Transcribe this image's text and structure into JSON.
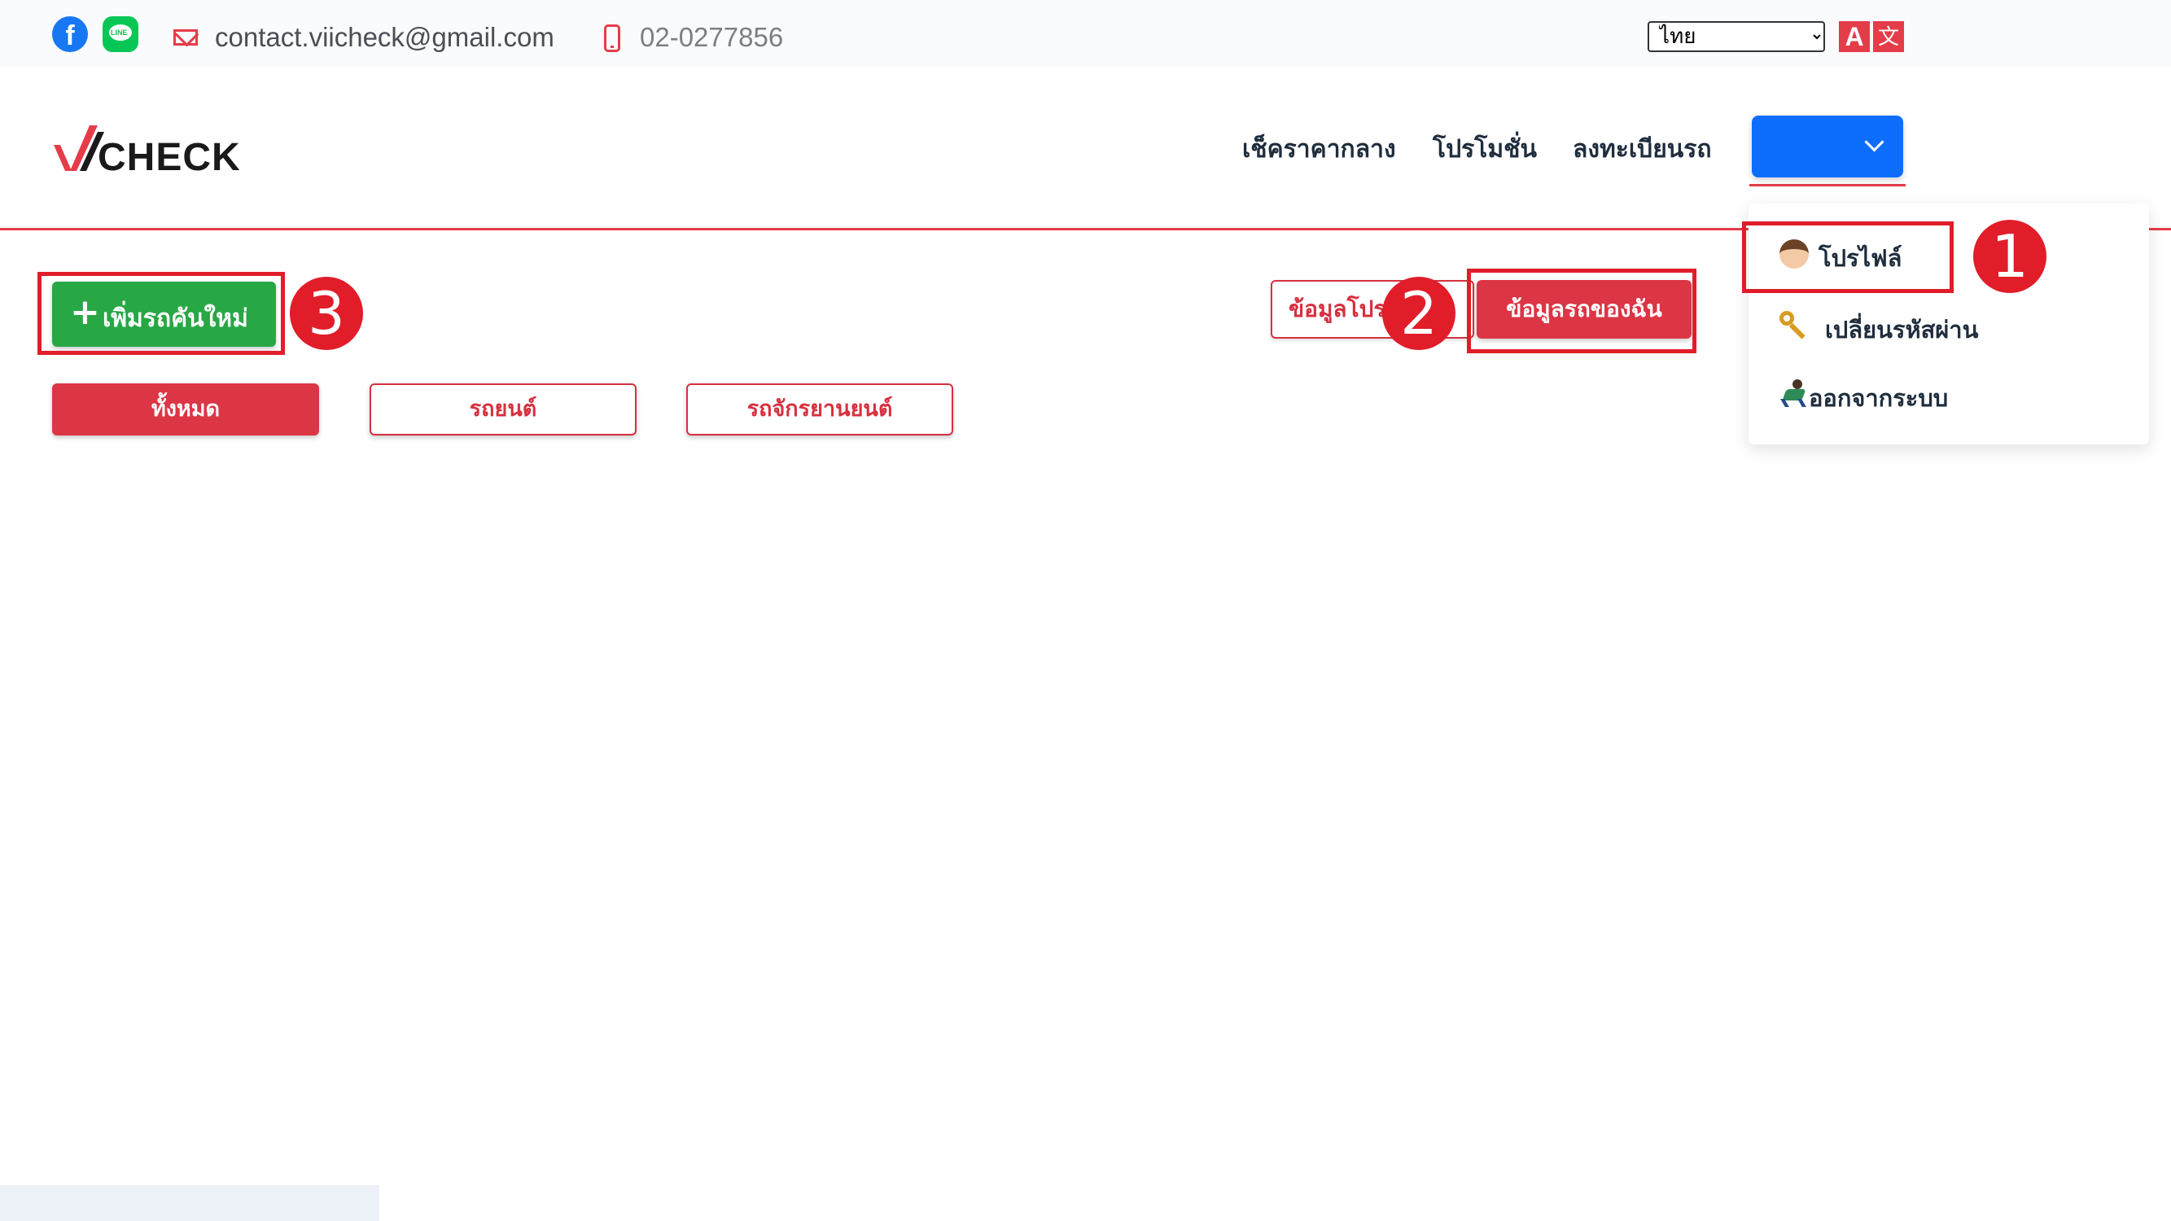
{
  "topbar": {
    "email": "contact.viicheck@gmail.com",
    "phone": "02-0277856",
    "language": {
      "selected": "ไทย",
      "options": [
        "ไทย"
      ]
    },
    "social_icons": [
      "facebook-icon",
      "line-icon"
    ],
    "line_icon_text": "LINE"
  },
  "header": {
    "logo_text": "CHECK",
    "nav": [
      "เช็คราคากลาง",
      "โปรโมชั่น",
      "ลงทะเบียนรถ"
    ]
  },
  "dropdown": {
    "items": [
      {
        "label": "โปรไฟล์",
        "icon": "face-icon"
      },
      {
        "label": "เปลี่ยนรหัสผ่าน",
        "icon": "key-icon"
      },
      {
        "label": "ออกจากระบบ",
        "icon": "runner-icon"
      }
    ]
  },
  "actions": {
    "add_vehicle": "เพิ่มรถคันใหม่",
    "tab_promo": "ข้อมูลโปรโมชั่น",
    "tab_my_cars": "ข้อมูลรถของฉัน"
  },
  "filters": [
    {
      "label": "ทั้งหมด",
      "active": true
    },
    {
      "label": "รถยนต์",
      "active": false
    },
    {
      "label": "รถจักรยานยนต์",
      "active": false
    }
  ],
  "annotations": [
    "1",
    "2",
    "3"
  ],
  "colors": {
    "brand_red": "#dc3545",
    "annotation_red": "#e11d2a",
    "primary_blue": "#0d6efd",
    "success_green": "#28a745"
  }
}
